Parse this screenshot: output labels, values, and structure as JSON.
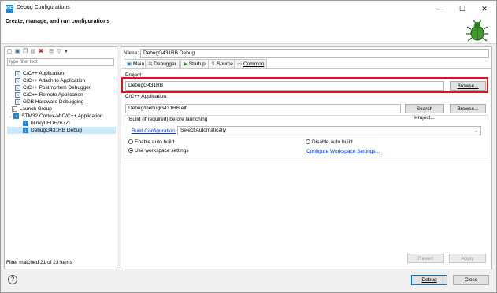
{
  "window": {
    "title": "Debug Configurations",
    "app_icon_text": "IDE",
    "minimize": "—",
    "maximize": "☐",
    "close": "✕"
  },
  "header": {
    "heading": "Create, manage, and run configurations"
  },
  "left": {
    "toolbar_icons": [
      "new-config-icon",
      "new-prototype-icon",
      "duplicate-icon",
      "export-icon",
      "delete-icon",
      "collapse-all-icon",
      "filter-icon",
      "dropdown-icon"
    ],
    "filter_placeholder": "type filter text",
    "tree": [
      {
        "label": "C/C++ Application",
        "indent": 1,
        "icon": "c"
      },
      {
        "label": "C/C++ Attach to Application",
        "indent": 1,
        "icon": "c"
      },
      {
        "label": "C/C++ Postmortem Debugger",
        "indent": 1,
        "icon": "c"
      },
      {
        "label": "C/C++ Remote Application",
        "indent": 1,
        "icon": "c"
      },
      {
        "label": "GDB Hardware Debugging",
        "indent": 1,
        "icon": "c"
      },
      {
        "label": "Launch Group",
        "indent": 0,
        "icon": "launch"
      },
      {
        "label": "STM32 Cortex-M C/C++ Application",
        "indent": 0,
        "icon": "ide"
      },
      {
        "label": "blinkyLEDF767ZI",
        "indent": 2,
        "icon": "ide"
      },
      {
        "label": "DebugG431RB Debug",
        "indent": 2,
        "icon": "ide",
        "selected": true
      }
    ],
    "status": "Filter matched 21 of 23 items"
  },
  "config": {
    "name_label": "Name:",
    "name_value": "DebugG431RB Debug",
    "tabs": [
      {
        "label": "Main",
        "active": true,
        "icon": "main"
      },
      {
        "label": "Debugger",
        "icon": "debugger"
      },
      {
        "label": "Startup",
        "icon": "startup"
      },
      {
        "label": "Source",
        "icon": "source"
      },
      {
        "label": "Common",
        "icon": "common"
      }
    ],
    "project_label": "Project:",
    "project_value": "DebugG431RB",
    "browse_label": "Browse...",
    "app_label": "C/C++ Application:",
    "app_value": "Debug/DebugG431RB.elf",
    "search_project_label": "Search Project...",
    "browse2_label": "Browse...",
    "build_group_label": "Build (if required) before launching",
    "build_config_link": "Build Configuration:",
    "build_config_value": "Select Automatically",
    "enable_auto_build": "Enable auto build",
    "disable_auto_build": "Disable auto build",
    "use_workspace": "Use workspace settings",
    "configure_workspace_link": "Configure Workspace Settings...",
    "revert_label": "Revert",
    "apply_label": "Apply"
  },
  "footer": {
    "help": "?",
    "debug_label": "Debug",
    "close_label": "Close"
  },
  "colors": {
    "highlight": "#e0131a",
    "selection": "#cce8ff",
    "accent": "#1e88d6"
  }
}
